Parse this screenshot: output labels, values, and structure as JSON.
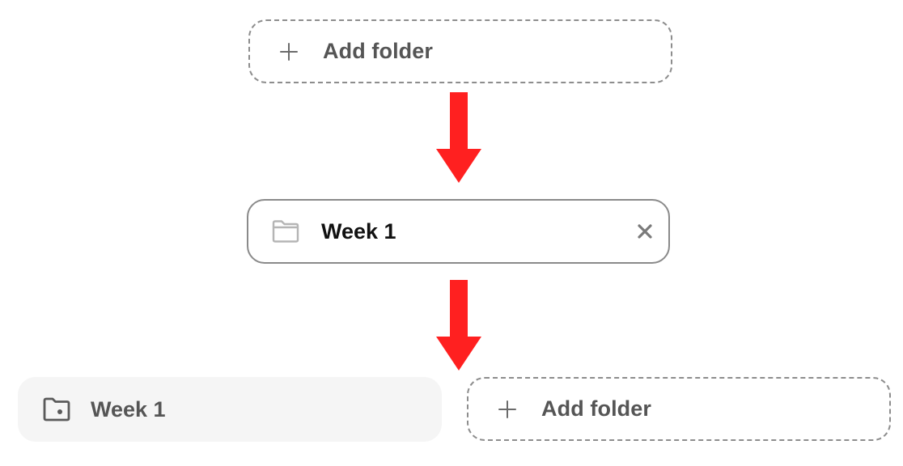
{
  "steps": {
    "add_folder_top": {
      "label": "Add folder",
      "icon": "plus-icon"
    },
    "editing": {
      "input_value": "Week 1",
      "icon": "folder-outline-icon",
      "clear_icon": "close-icon"
    },
    "created_folder": {
      "label": "Week 1",
      "icon": "folder-dot-icon"
    },
    "add_folder_bottom": {
      "label": "Add folder",
      "icon": "plus-icon"
    }
  },
  "colors": {
    "arrow": "#ff2020",
    "dashed_border": "#8d8d8d",
    "label_gray": "#555555",
    "input_text": "#111111",
    "created_bg": "#f5f5f5"
  }
}
